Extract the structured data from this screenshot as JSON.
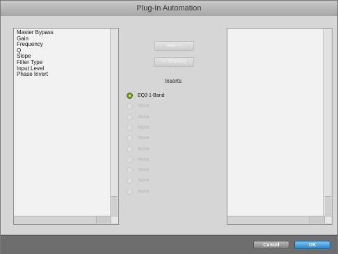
{
  "window": {
    "title": "Plug-In Automation"
  },
  "left_list": {
    "items": [
      "Master Bypass",
      "Gain",
      "Frequency",
      "Q",
      "Slope",
      "Filter Type",
      "Input Level",
      "Phase Invert"
    ]
  },
  "buttons": {
    "add_label": "Add >>",
    "remove_label": "<< Remove",
    "cancel_label": "Cancel",
    "ok_label": "OK"
  },
  "inserts": {
    "label": "Inserts",
    "options": [
      {
        "label": "EQ3 1-Band",
        "selected": true
      },
      {
        "label": "None",
        "selected": false
      },
      {
        "label": "None",
        "selected": false
      },
      {
        "label": "None",
        "selected": false
      },
      {
        "label": "None",
        "selected": false
      },
      {
        "label": "None",
        "selected": false
      },
      {
        "label": "None",
        "selected": false
      },
      {
        "label": "None",
        "selected": false
      },
      {
        "label": "None",
        "selected": false
      },
      {
        "label": "None",
        "selected": false
      }
    ]
  },
  "colors": {
    "accent_ok": "#2a86c9",
    "radio_selected": "#6d9a22"
  }
}
